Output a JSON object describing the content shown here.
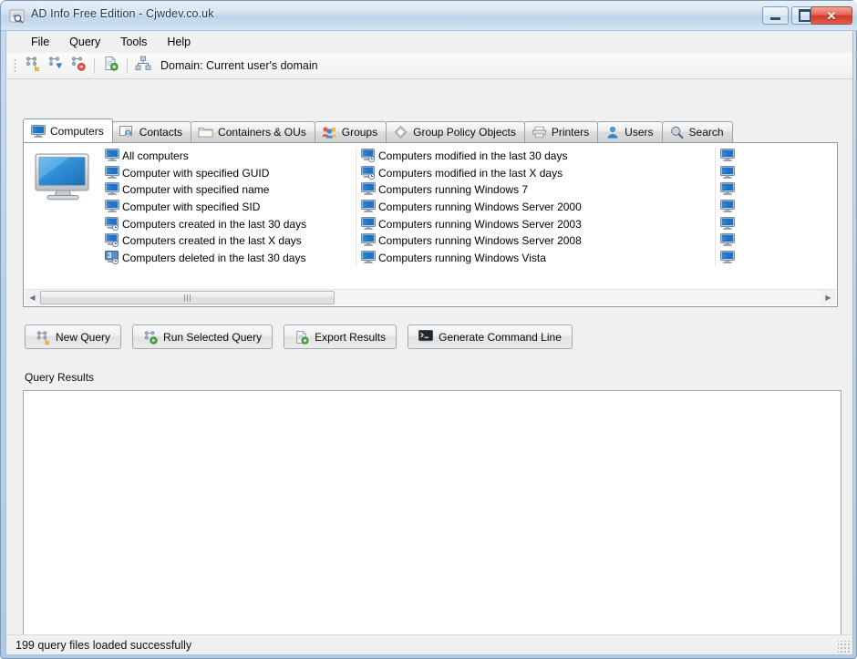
{
  "window": {
    "title": "AD Info Free Edition - Cjwdev.co.uk",
    "icon": "app-window-icon",
    "controls": {
      "minimize": "minimize-icon",
      "maximize": "maximize-icon",
      "close": "close-icon"
    }
  },
  "menubar": {
    "items": [
      {
        "label": "File"
      },
      {
        "label": "Query"
      },
      {
        "label": "Tools"
      },
      {
        "label": "Help"
      }
    ]
  },
  "toolbar": {
    "buttons": [
      {
        "icon": "new-query-icon"
      },
      {
        "icon": "run-query-icon"
      },
      {
        "icon": "delete-query-icon"
      },
      {
        "icon": "export-results-icon"
      },
      {
        "icon": "domain-icon"
      }
    ],
    "domain_label": "Domain: Current user's domain"
  },
  "tabs": [
    {
      "label": "Computers",
      "icon": "monitor-icon",
      "active": true
    },
    {
      "label": "Contacts",
      "icon": "contact-card-icon",
      "active": false
    },
    {
      "label": "Containers & OUs",
      "icon": "folder-icon",
      "active": false
    },
    {
      "label": "Groups",
      "icon": "group-people-icon",
      "active": false
    },
    {
      "label": "Group Policy Objects",
      "icon": "gpo-scroll-icon",
      "active": false
    },
    {
      "label": "Printers",
      "icon": "printer-icon",
      "active": false
    },
    {
      "label": "Users",
      "icon": "user-icon",
      "active": false
    },
    {
      "label": "Search",
      "icon": "search-icon",
      "active": false
    }
  ],
  "computers_tab": {
    "big_icon": "large-monitor-icon",
    "query_columns": [
      {
        "items": [
          {
            "label": "All computers",
            "icon": "monitor-icon"
          },
          {
            "label": "Computer with specified GUID",
            "icon": "monitor-icon"
          },
          {
            "label": "Computer with specified name",
            "icon": "monitor-icon"
          },
          {
            "label": "Computer with specified SID",
            "icon": "monitor-icon"
          },
          {
            "label": "Computers created in the last 30 days",
            "icon": "monitor-clock-icon"
          },
          {
            "label": "Computers created in the last X days",
            "icon": "monitor-clock-icon"
          },
          {
            "label": "Computers deleted in the last 30 days",
            "icon": "monitor-deleted-icon"
          }
        ]
      },
      {
        "items": [
          {
            "label": "Computers modified in the last 30 days",
            "icon": "monitor-clock-icon"
          },
          {
            "label": "Computers modified in the last X days",
            "icon": "monitor-clock-icon"
          },
          {
            "label": "Computers running Windows 7",
            "icon": "monitor-icon"
          },
          {
            "label": "Computers running Windows Server 2000",
            "icon": "monitor-icon"
          },
          {
            "label": "Computers running Windows Server 2003",
            "icon": "monitor-icon"
          },
          {
            "label": "Computers running Windows Server 2008",
            "icon": "monitor-icon"
          },
          {
            "label": "Computers running Windows Vista",
            "icon": "monitor-icon"
          }
        ]
      },
      {
        "items": [
          {
            "label": "",
            "icon": "monitor-icon"
          },
          {
            "label": "",
            "icon": "monitor-icon"
          },
          {
            "label": "",
            "icon": "monitor-icon"
          },
          {
            "label": "",
            "icon": "monitor-icon"
          },
          {
            "label": "",
            "icon": "monitor-icon"
          },
          {
            "label": "",
            "icon": "monitor-icon"
          },
          {
            "label": "",
            "icon": "monitor-icon"
          }
        ]
      }
    ],
    "scrollbar": {
      "left_arrow": "scroll-left-arrow-icon",
      "right_arrow": "scroll-right-arrow-icon"
    }
  },
  "actions": [
    {
      "label": "New Query",
      "icon": "new-query-icon"
    },
    {
      "label": "Run Selected Query",
      "icon": "run-query-icon"
    },
    {
      "label": "Export Results",
      "icon": "export-results-icon"
    },
    {
      "label": "Generate Command Line",
      "icon": "command-line-icon"
    }
  ],
  "results": {
    "group_label": "Query Results",
    "content": ""
  },
  "statusbar": {
    "text": "199 query files loaded successfully",
    "grip": "resize-grip-icon"
  },
  "colors": {
    "title_accent": "#bed4ea",
    "close_button": "#cf3a28",
    "icon_blue": "#2e7fd4",
    "panel_bg": "#f0f0f0"
  }
}
